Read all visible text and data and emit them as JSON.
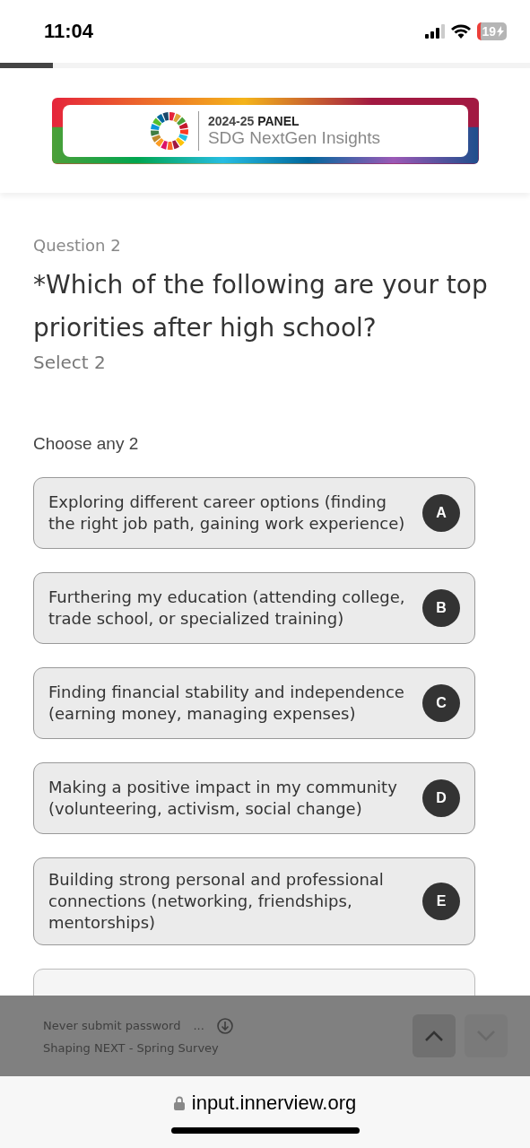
{
  "status_bar": {
    "time": "11:04",
    "battery": "19"
  },
  "progress": {
    "level": 0.1
  },
  "banner": {
    "line_1": "2024-25 **PANEL**",
    "line_2": "SDG NextGen Insights"
  },
  "question": {
    "number": "Question 2",
    "title": "*Which of the following are your top priorities after high school?",
    "hint": "Select 2",
    "instruction": "Choose any 2"
  },
  "options": [
    {
      "text": "Exploring different career options (finding the right job path, gaining work experience)",
      "key": "A",
      "selected": false
    },
    {
      "text": "Furthering my education (attending college, trade school, or specialized training)",
      "key": "B",
      "selected": false
    },
    {
      "text": "Finding financial stability and independence (earning money, managing expenses)",
      "key": "C",
      "selected": false
    },
    {
      "text": "Making a positive impact in my community (volunteering, activism, social change)",
      "key": "D",
      "selected": false
    },
    {
      "text": "Building strong personal and professional connections (networking, friendships, mentorships)",
      "key": "E",
      "selected": false
    }
  ],
  "footer": {
    "line_1": "Never submit password",
    "ellipsis": "...",
    "line_2": "Shaping NEXT - Spring Survey"
  },
  "browser": {
    "url": "input.innerview.org"
  }
}
